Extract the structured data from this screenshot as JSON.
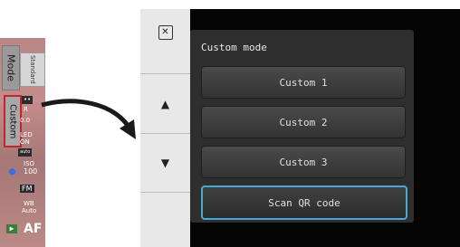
{
  "left_strip": {
    "mode_label": "Mode",
    "standard_label": "Standard",
    "custom_label": "Custom",
    "icons": {
      "r_label": "R",
      "ev_label": "0.0",
      "led_label": "LED",
      "led_state": "ON",
      "iso_label": "ISO",
      "iso_value": "100",
      "fm_label": "FM",
      "wb_label": "WB",
      "wb_value": "Auto",
      "af_label": "AF"
    }
  },
  "side_buttons": {
    "delete_icon": "x-box-icon",
    "up_icon": "triangle-up-icon",
    "down_icon": "triangle-down-icon"
  },
  "menu": {
    "title": "Custom mode",
    "buttons": [
      "Custom 1",
      "Custom 2",
      "Custom 3",
      "Scan QR code"
    ]
  },
  "colors": {
    "highlight_border": "#c0262c",
    "focus_border": "#4aa8d8"
  }
}
